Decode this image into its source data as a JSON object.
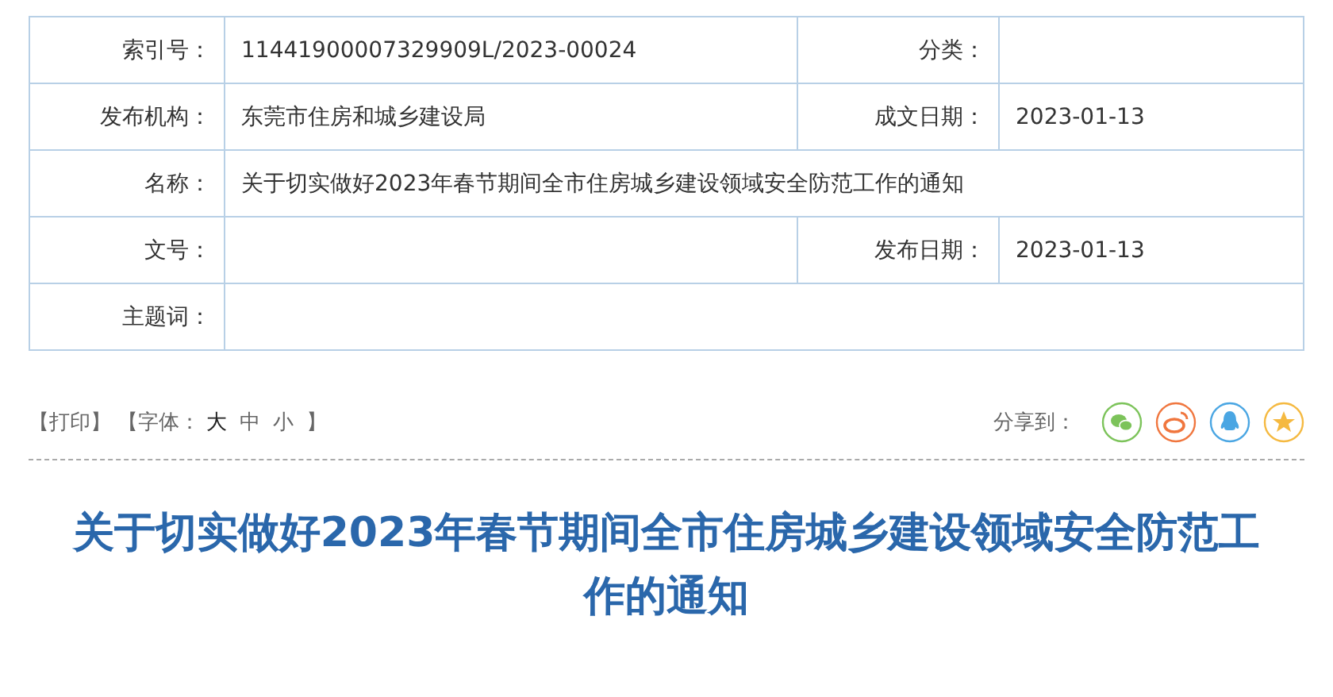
{
  "info_table": {
    "rows": [
      {
        "cells": [
          {
            "label": "索引号：",
            "value": "11441900007329909L/2023-00024"
          },
          {
            "label": "分类："
          }
        ]
      },
      {
        "cells": [
          {
            "label": "发布机构：",
            "value": "东莞市住房和城乡建设局"
          },
          {
            "label": "成文日期：",
            "value": "2023-01-13"
          }
        ]
      },
      {
        "cells": [
          {
            "label": "名称：",
            "value": "关于切实做好2023年春节期间全市住房城乡建设领域安全防范工作的通知"
          }
        ]
      },
      {
        "cells": [
          {
            "label": "文号："
          },
          {
            "label": "发布日期：",
            "value": "2023-01-13"
          }
        ]
      },
      {
        "cells": [
          {
            "label": "主题词："
          }
        ]
      }
    ]
  },
  "tools": {
    "print": "【打印】",
    "font_prefix": "【字体：",
    "font_sizes": [
      {
        "label": "大",
        "selected": true
      },
      {
        "label": "中",
        "selected": false
      },
      {
        "label": "小",
        "selected": false
      }
    ],
    "font_suffix": "】",
    "share_label": "分享到："
  },
  "article_title": "关于切实做好2023年春节期间全市住房城乡建设领域安全防范工作的通知"
}
